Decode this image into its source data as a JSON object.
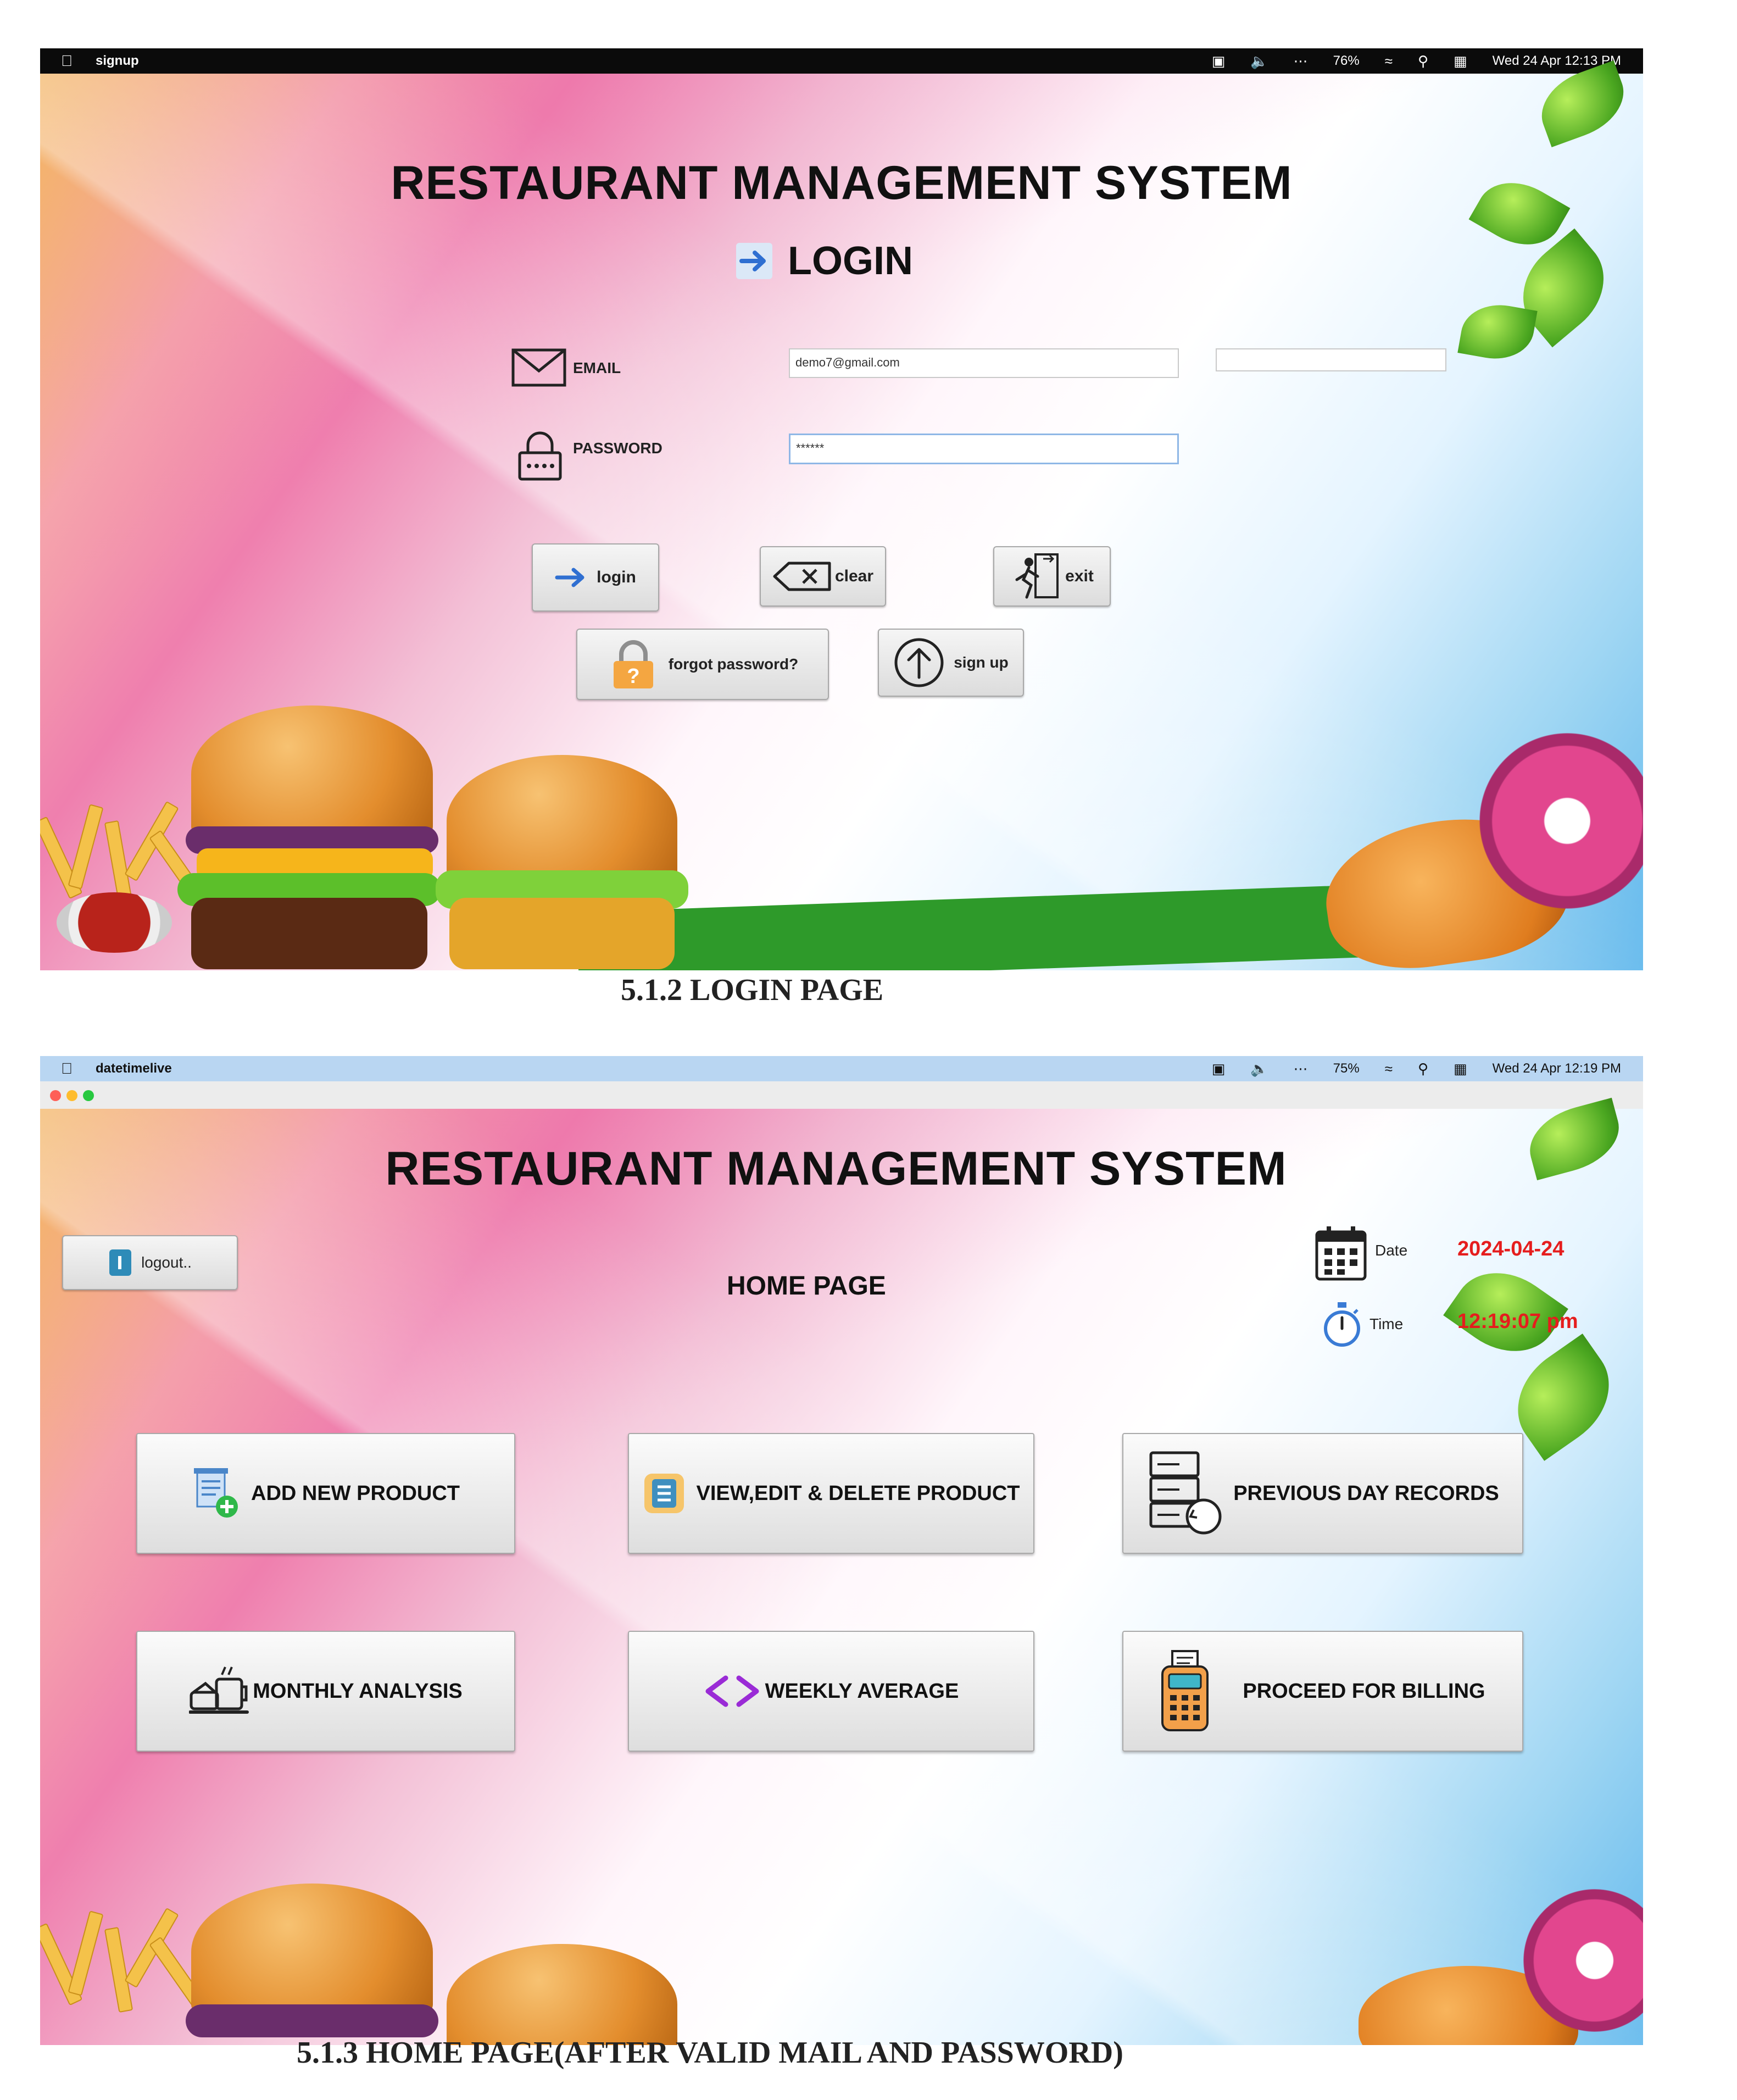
{
  "login_screen": {
    "menubar": {
      "app_name": "signup",
      "battery": "76%",
      "datetime": "Wed 24 Apr 12:13 PM"
    },
    "title": "RESTAURANT MANAGEMENT SYSTEM",
    "heading": "LOGIN",
    "email_label": "EMAIL",
    "email_value": "demo7@gmail.com",
    "password_label": "PASSWORD",
    "password_value": "******",
    "buttons": {
      "login": "login",
      "clear": "clear",
      "exit": "exit",
      "forgot": "forgot password?",
      "signup": "sign up"
    },
    "caption": "5.1.2 LOGIN PAGE"
  },
  "home_screen": {
    "menubar": {
      "app_name": "datetimelive",
      "battery": "75%",
      "datetime": "Wed 24 Apr 12:19 PM"
    },
    "title": "RESTAURANT MANAGEMENT SYSTEM",
    "heading": "HOME PAGE",
    "logout_label": "logout..",
    "date_label": "Date",
    "date_value": "2024-04-24",
    "time_label": "Time",
    "time_value": "12:19:07 pm",
    "accent_color": "#e51d1d",
    "buttons": {
      "add_product": "ADD NEW PRODUCT",
      "view_edit": "VIEW,EDIT & DELETE PRODUCT",
      "previous_day": "PREVIOUS DAY RECORDS",
      "monthly": "MONTHLY ANALYSIS",
      "weekly": "WEEKLY AVERAGE",
      "billing": "PROCEED FOR BILLING"
    },
    "caption": "5.1.3 HOME PAGE(AFTER VALID MAIL AND PASSWORD)"
  }
}
